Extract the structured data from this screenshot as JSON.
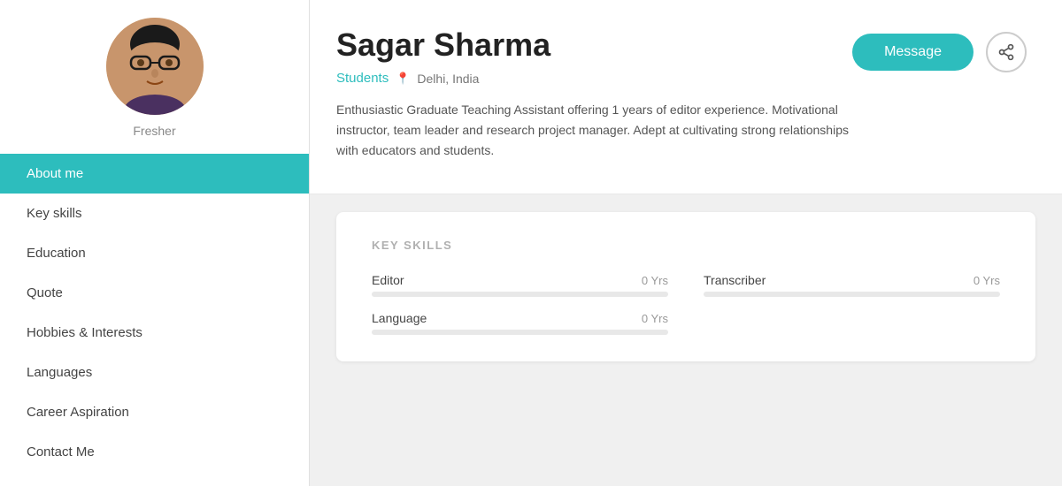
{
  "sidebar": {
    "fresher_label": "Fresher",
    "nav_items": [
      {
        "id": "about-me",
        "label": "About me",
        "active": true
      },
      {
        "id": "key-skills",
        "label": "Key skills",
        "active": false
      },
      {
        "id": "education",
        "label": "Education",
        "active": false
      },
      {
        "id": "quote",
        "label": "Quote",
        "active": false
      },
      {
        "id": "hobbies",
        "label": "Hobbies & Interests",
        "active": false
      },
      {
        "id": "languages",
        "label": "Languages",
        "active": false
      },
      {
        "id": "career-aspiration",
        "label": "Career Aspiration",
        "active": false
      },
      {
        "id": "contact-me",
        "label": "Contact Me",
        "active": false
      }
    ]
  },
  "profile": {
    "name": "Sagar Sharma",
    "role": "Students",
    "location": "Delhi, India",
    "bio": "Enthusiastic Graduate Teaching Assistant offering 1 years of editor experience. Motivational instructor, team leader and research project manager. Adept at cultivating strong relationships with educators and students.",
    "message_button": "Message",
    "share_button_label": "Share"
  },
  "key_skills": {
    "section_title": "KEY SKILLS",
    "skills": [
      {
        "name": "Editor",
        "years": "0 Yrs",
        "percent": 0
      },
      {
        "name": "Transcriber",
        "years": "0 Yrs",
        "percent": 0
      },
      {
        "name": "Language",
        "years": "0 Yrs",
        "percent": 0
      }
    ]
  }
}
